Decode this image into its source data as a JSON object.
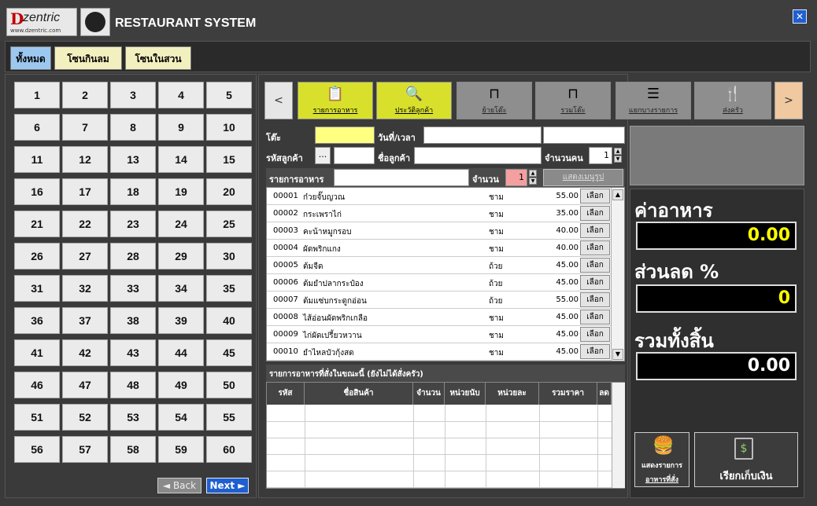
{
  "app": {
    "title": "RESTAURANT SYSTEM",
    "logo_d": "D",
    "logo_name": "zentric",
    "logo_url": "www.dzentric.com",
    "close_glyph": "✕"
  },
  "zones": {
    "all": "ทั้งหมด",
    "zone1": "โซนกินลม",
    "zone2": "โซนในสวน"
  },
  "tables": [
    "1",
    "2",
    "3",
    "4",
    "5",
    "6",
    "7",
    "8",
    "9",
    "10",
    "11",
    "12",
    "13",
    "14",
    "15",
    "16",
    "17",
    "18",
    "19",
    "20",
    "21",
    "22",
    "23",
    "24",
    "25",
    "26",
    "27",
    "28",
    "29",
    "30",
    "31",
    "32",
    "33",
    "34",
    "35",
    "36",
    "37",
    "38",
    "39",
    "40",
    "41",
    "42",
    "43",
    "44",
    "45",
    "46",
    "47",
    "48",
    "49",
    "50",
    "51",
    "52",
    "53",
    "54",
    "55",
    "56",
    "57",
    "58",
    "59",
    "60"
  ],
  "pager": {
    "back": "◄ Back",
    "next": "Next ►"
  },
  "toolbar": {
    "prev": "<",
    "next": ">",
    "menu_list": "รายการอาหาร",
    "customer_history": "ประวัติลูกค้า",
    "move_table": "ย้ายโต๊ะ",
    "merge_table": "รวมโต๊ะ",
    "split_items": "แยกบางรายการ",
    "send_kitchen": "ส่งครัว"
  },
  "form": {
    "table_label": "โต๊ะ",
    "datetime_label": "วันที่/เวลา",
    "customer_code_label": "รหัสลูกค้า",
    "browse": "...",
    "customer_name_label": "ชื่อลูกค้า",
    "guests_label": "จำนวนคน",
    "guests_value": "1",
    "menu_search_label": "รายการอาหาร",
    "qty_label": "จำนวน",
    "qty_value": "1",
    "show_images": "แสดงเมนูรูป"
  },
  "menu_items": [
    {
      "code": "00001",
      "name": "ก๋วยจั๊บญวณ",
      "unit": "ชาม",
      "price": "55.00",
      "pick": "เลือก"
    },
    {
      "code": "00002",
      "name": "กระเพราไก่",
      "unit": "ชาม",
      "price": "35.00",
      "pick": "เลือก"
    },
    {
      "code": "00003",
      "name": "คะน้าหมูกรอบ",
      "unit": "ชาม",
      "price": "40.00",
      "pick": "เลือก"
    },
    {
      "code": "00004",
      "name": "ผัดพริกแกง",
      "unit": "ชาม",
      "price": "40.00",
      "pick": "เลือก"
    },
    {
      "code": "00005",
      "name": "ต้มจืด",
      "unit": "ถ้วย",
      "price": "45.00",
      "pick": "เลือก"
    },
    {
      "code": "00006",
      "name": "ต้มยำปลากระป๋อง",
      "unit": "ถ้วย",
      "price": "45.00",
      "pick": "เลือก"
    },
    {
      "code": "00007",
      "name": "ต้มแซ่บกระดูกอ่อน",
      "unit": "ถ้วย",
      "price": "55.00",
      "pick": "เลือก"
    },
    {
      "code": "00008",
      "name": "ไส้อ่อนผัดพริกเกลือ",
      "unit": "ชาม",
      "price": "45.00",
      "pick": "เลือก"
    },
    {
      "code": "00009",
      "name": "ไก่ผัดเปรี้ยวหวาน",
      "unit": "ชาม",
      "price": "45.00",
      "pick": "เลือก"
    },
    {
      "code": "00010",
      "name": "ยำไหลบัวกุ้งสด",
      "unit": "ชาม",
      "price": "45.00",
      "pick": "เลือก"
    }
  ],
  "order": {
    "caption": "รายการอาหารที่สั่งในขณะนี้ (ยังไม่ได้สั่งครัว)",
    "cols": [
      "รหัส",
      "ชื่อสินค้า",
      "จำนวน",
      "หน่วยนับ",
      "หน่วยละ",
      "รวมราคา",
      "ลด"
    ]
  },
  "summary": {
    "food_label": "ค่าอาหาร",
    "food_value": "0.00",
    "discount_label": "ส่วนลด %",
    "discount_value": "0",
    "total_label": "รวมทั้งสิ้น",
    "total_value": "0.00",
    "show_order_line1": "แสดงรายการ",
    "show_order_line2": "อาหารที่สั่ง",
    "pay": "เรียกเก็บเงิน"
  },
  "colors": {
    "accent_yellow": "#d8e02c",
    "blue": "#1f5fd0",
    "zone_all": "#9cc8f0",
    "zone": "#f3f0c0"
  }
}
